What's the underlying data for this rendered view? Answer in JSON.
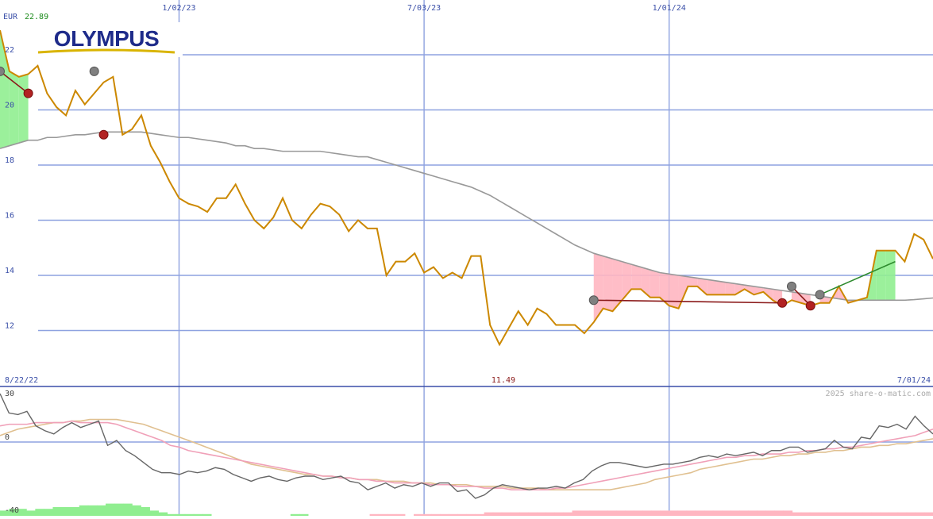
{
  "chart_data": [
    {
      "type": "line",
      "currency_label": "EUR",
      "last_price": "22.89",
      "brand_logo_text": "OLYMPUS",
      "y_ticks": [
        12,
        14,
        16,
        18,
        20,
        22
      ],
      "ylim": [
        10.0,
        23.9
      ],
      "x_tick_labels": [
        "1/02/23",
        "7/03/23",
        "1/01/24"
      ],
      "x_tick_weeks": [
        19,
        45,
        71
      ],
      "start_date": "8/22/22",
      "end_date": "7/01/24",
      "min_label": "11.49",
      "min_week": 54,
      "series": [
        {
          "values": [
            22.89,
            21.4,
            21.2,
            21.3,
            21.6,
            20.6,
            20.1,
            19.8,
            20.7,
            20.2,
            20.6,
            21.0,
            21.2,
            19.1,
            19.3,
            19.8,
            18.7,
            18.1,
            17.4,
            16.8,
            16.6,
            16.5,
            16.3,
            16.8,
            16.8,
            17.3,
            16.6,
            16.0,
            15.7,
            16.1,
            16.8,
            16.0,
            15.7,
            16.2,
            16.6,
            16.5,
            16.2,
            15.6,
            16.0,
            15.7,
            15.7,
            14.0,
            14.5,
            14.5,
            14.8,
            14.1,
            14.3,
            13.9,
            14.1,
            13.9,
            14.7,
            14.7,
            12.2,
            11.49,
            12.1,
            12.7,
            12.2,
            12.8,
            12.6,
            12.2,
            12.2,
            12.2,
            11.9,
            12.3,
            12.8,
            12.7,
            13.1,
            13.5,
            13.5,
            13.2,
            13.2,
            12.9,
            12.8,
            13.6,
            13.6,
            13.3,
            13.3,
            13.3,
            13.3,
            13.5,
            13.3,
            13.4,
            13.1,
            12.9,
            13.1,
            13.0,
            12.9,
            13.0,
            13.0,
            13.6,
            13.0,
            13.1,
            13.2,
            14.9,
            14.9,
            14.9,
            14.5,
            15.5,
            15.3,
            14.6
          ]
        },
        {
          "values": [
            18.6,
            18.7,
            18.8,
            18.9,
            18.9,
            19.0,
            19.0,
            19.05,
            19.1,
            19.1,
            19.15,
            19.2,
            19.2,
            19.2,
            19.2,
            19.2,
            19.15,
            19.1,
            19.05,
            19.0,
            19.0,
            18.95,
            18.9,
            18.85,
            18.8,
            18.7,
            18.7,
            18.6,
            18.6,
            18.55,
            18.5,
            18.5,
            18.5,
            18.5,
            18.5,
            18.45,
            18.4,
            18.35,
            18.3,
            18.3,
            18.2,
            18.1,
            18.0,
            17.9,
            17.8,
            17.7,
            17.6,
            17.5,
            17.4,
            17.3,
            17.2,
            17.05,
            16.9,
            16.7,
            16.5,
            16.3,
            16.1,
            15.9,
            15.7,
            15.5,
            15.3,
            15.1,
            14.95,
            14.8,
            14.7,
            14.6,
            14.5,
            14.4,
            14.3,
            14.2,
            14.1,
            14.05,
            14.0,
            13.95,
            13.9,
            13.85,
            13.8,
            13.75,
            13.7,
            13.65,
            13.6,
            13.55,
            13.5,
            13.45,
            13.4,
            13.35,
            13.3,
            13.25,
            13.2,
            13.15,
            13.1,
            13.1,
            13.1,
            13.1,
            13.1,
            13.1,
            13.1,
            13.12,
            13.15,
            13.18
          ]
        }
      ],
      "signal_points": [
        {
          "week": 0,
          "value": 21.4,
          "kind": "grey"
        },
        {
          "week": 3,
          "value": 20.6,
          "kind": "red"
        },
        {
          "week": 10,
          "value": 21.4,
          "kind": "grey"
        },
        {
          "week": 11,
          "value": 19.1,
          "kind": "red"
        },
        {
          "week": 63,
          "value": 13.1,
          "kind": "grey"
        },
        {
          "week": 83,
          "value": 13.0,
          "kind": "red"
        },
        {
          "week": 84,
          "value": 13.6,
          "kind": "grey"
        },
        {
          "week": 86,
          "value": 12.9,
          "kind": "red"
        },
        {
          "week": 87,
          "value": 13.3,
          "kind": "grey"
        }
      ],
      "trend_segments": [
        {
          "x0": 0,
          "y0": 21.4,
          "x1": 3,
          "y1": 20.6,
          "color": "#8b1a1a"
        },
        {
          "x0": 63,
          "y0": 13.1,
          "x1": 83,
          "y1": 13.0,
          "color": "#8b1a1a"
        },
        {
          "x0": 84,
          "y0": 13.6,
          "x1": 86,
          "y1": 12.9,
          "color": "#8b1a1a"
        },
        {
          "x0": 87,
          "y0": 13.3,
          "x1": 95,
          "y1": 14.5,
          "color": "#2e8b2e"
        }
      ],
      "colors": {
        "price": "#cc8800",
        "moving_average": "#999999",
        "grid": "#8ea2e0",
        "fill_up": "#90ee90",
        "fill_down": "#ffb6c1",
        "axis_text": "#3a4fa8",
        "last_price": "#1a8a1a",
        "min_label": "#8b1a1a"
      }
    },
    {
      "type": "line",
      "y_ticks": [
        30,
        0,
        -40
      ],
      "ylim": [
        -40,
        30
      ],
      "watermark": "2025 share-o-matic.com",
      "series": [
        {
          "values": [
            30,
            18,
            17,
            19,
            10,
            7,
            5,
            9,
            12,
            9,
            11,
            13,
            -2,
            1,
            -5,
            -8,
            -12,
            -16,
            -18,
            -18,
            -19,
            -17,
            -18,
            -17,
            -15,
            -16,
            -19,
            -21,
            -23,
            -21,
            -20,
            -22,
            -23,
            -21,
            -20,
            -20,
            -22,
            -21,
            -20,
            -23,
            -24,
            -28,
            -26,
            -24,
            -27,
            -25,
            -26,
            -24,
            -26,
            -24,
            -24,
            -29,
            -28,
            -33,
            -31,
            -27,
            -25,
            -26,
            -27,
            -28,
            -27,
            -27,
            -26,
            -27,
            -24,
            -22,
            -17,
            -14,
            -12,
            -12,
            -13,
            -14,
            -15,
            -14,
            -13,
            -13,
            -12,
            -11,
            -9,
            -8,
            -9,
            -7,
            -8,
            -7,
            -6,
            -8,
            -5,
            -5,
            -3,
            -3,
            -6,
            -5,
            -4,
            1,
            -3,
            -4,
            3,
            2,
            10,
            9,
            11,
            8,
            16,
            10,
            5
          ]
        },
        {
          "values": [
            10,
            11,
            11,
            11,
            12,
            12,
            12,
            12,
            13,
            12,
            12,
            12,
            12,
            11,
            9,
            7,
            5,
            3,
            1,
            -2,
            -3,
            -5,
            -6,
            -7,
            -8,
            -9,
            -10,
            -11,
            -12,
            -13,
            -14,
            -15,
            -16,
            -17,
            -18,
            -19,
            -20,
            -20,
            -21,
            -21,
            -22,
            -22,
            -23,
            -23,
            -24,
            -24,
            -24,
            -24,
            -25,
            -25,
            -25,
            -26,
            -26,
            -26,
            -27,
            -27,
            -27,
            -28,
            -28,
            -28,
            -28,
            -28,
            -27,
            -27,
            -26,
            -25,
            -24,
            -23,
            -22,
            -21,
            -20,
            -19,
            -18,
            -17,
            -16,
            -15,
            -14,
            -13,
            -12,
            -11,
            -10,
            -9,
            -9,
            -8,
            -8,
            -7,
            -7,
            -7,
            -6,
            -6,
            -5,
            -5,
            -4,
            -4,
            -3,
            -3,
            -2,
            -1,
            0,
            1,
            2,
            3,
            4,
            6,
            8
          ]
        },
        {
          "values": [
            4,
            6,
            8,
            9,
            10,
            11,
            12,
            12,
            13,
            13,
            14,
            14,
            14,
            14,
            13,
            12,
            11,
            9,
            7,
            5,
            3,
            1,
            -1,
            -3,
            -5,
            -7,
            -9,
            -11,
            -13,
            -14,
            -15,
            -16,
            -17,
            -18,
            -19,
            -19,
            -20,
            -20,
            -21,
            -21,
            -22,
            -22,
            -22,
            -23,
            -23,
            -23,
            -24,
            -24,
            -24,
            -25,
            -25,
            -25,
            -25,
            -26,
            -26,
            -26,
            -26,
            -27,
            -27,
            -27,
            -27,
            -28,
            -28,
            -28,
            -28,
            -28,
            -28,
            -28,
            -28,
            -27,
            -26,
            -25,
            -24,
            -22,
            -21,
            -20,
            -19,
            -18,
            -16,
            -15,
            -14,
            -13,
            -12,
            -11,
            -10,
            -10,
            -9,
            -8,
            -8,
            -7,
            -7,
            -6,
            -6,
            -5,
            -5,
            -4,
            -3,
            -3,
            -2,
            -2,
            -1,
            -1,
            0,
            1,
            2
          ]
        }
      ],
      "histogram": [
        3,
        4,
        4,
        3,
        4,
        4,
        5,
        5,
        5,
        6,
        6,
        6,
        7,
        7,
        7,
        6,
        5,
        3,
        2,
        1,
        1,
        1,
        1,
        1,
        0,
        0,
        0,
        0,
        0,
        0,
        0,
        0,
        0,
        1,
        1,
        0,
        0,
        0,
        0,
        0,
        0,
        0,
        -1,
        -1,
        -1,
        -1,
        0,
        -1,
        -1,
        -1,
        -1,
        -1,
        -1,
        -1,
        -1,
        -2,
        -2,
        -2,
        -2,
        -2,
        -2,
        -2,
        -2,
        -2,
        -2,
        -3,
        -3,
        -3,
        -3,
        -3,
        -3,
        -3,
        -3,
        -3,
        -3,
        -3,
        -3,
        -3,
        -3,
        -3,
        -3,
        -3,
        -3,
        -3,
        -3,
        -3,
        -3,
        -3,
        -3,
        -3,
        -2,
        -2,
        -2,
        -2,
        -2,
        -2,
        -2,
        -2,
        -2,
        -2,
        -2,
        -2,
        -2,
        -2,
        -2,
        -2
      ],
      "colors": {
        "momentum": "#666666",
        "signal_pink": "#f0a0b8",
        "signal_tan": "#e0c090",
        "hist_pos": "#90ee90",
        "hist_neg": "#ffb6c1",
        "zero_line": "#8ea2e0"
      }
    }
  ]
}
